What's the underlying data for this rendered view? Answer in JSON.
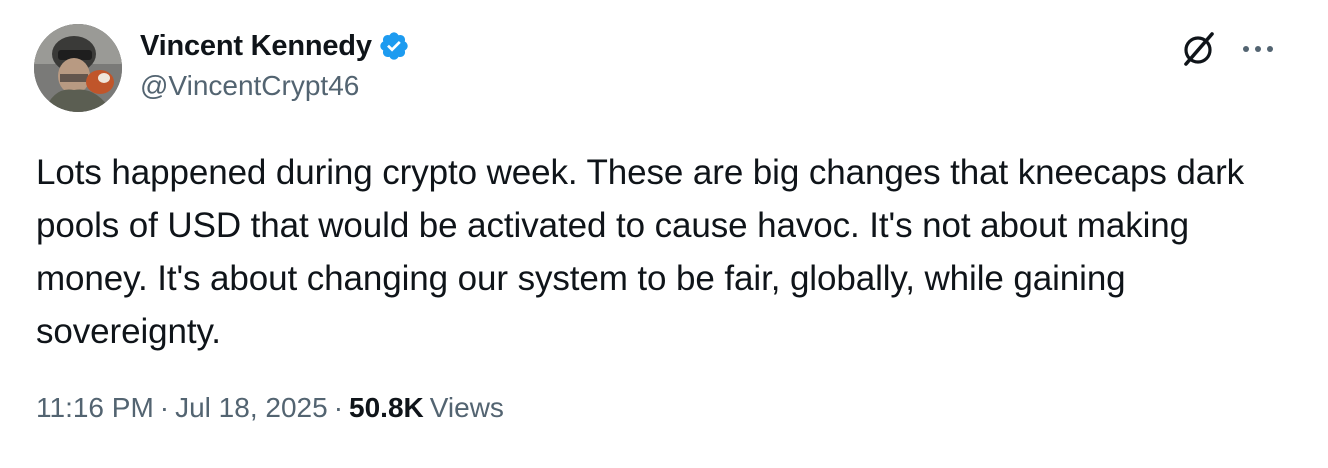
{
  "author": {
    "display_name": "Vincent Kennedy",
    "handle": "@VincentCrypt46",
    "verified": true
  },
  "icons": {
    "avatar": "profile-photo",
    "verified_badge": "verified-badge-icon",
    "grok": "grok-icon",
    "more": "more-options-icon"
  },
  "tweet": {
    "text": "Lots happened during crypto week. These are big changes that kneecaps dark pools of USD that would be activated to cause havoc. It's not about making money. It's about changing our system to be fair, globally, while gaining sovereignty."
  },
  "meta": {
    "time": "11:16 PM",
    "separator": "·",
    "date": "Jul 18, 2025",
    "views_count": "50.8K",
    "views_label": "Views"
  },
  "colors": {
    "text_primary": "#0f1419",
    "text_secondary": "#536471",
    "verified_blue": "#1d9bf0"
  }
}
